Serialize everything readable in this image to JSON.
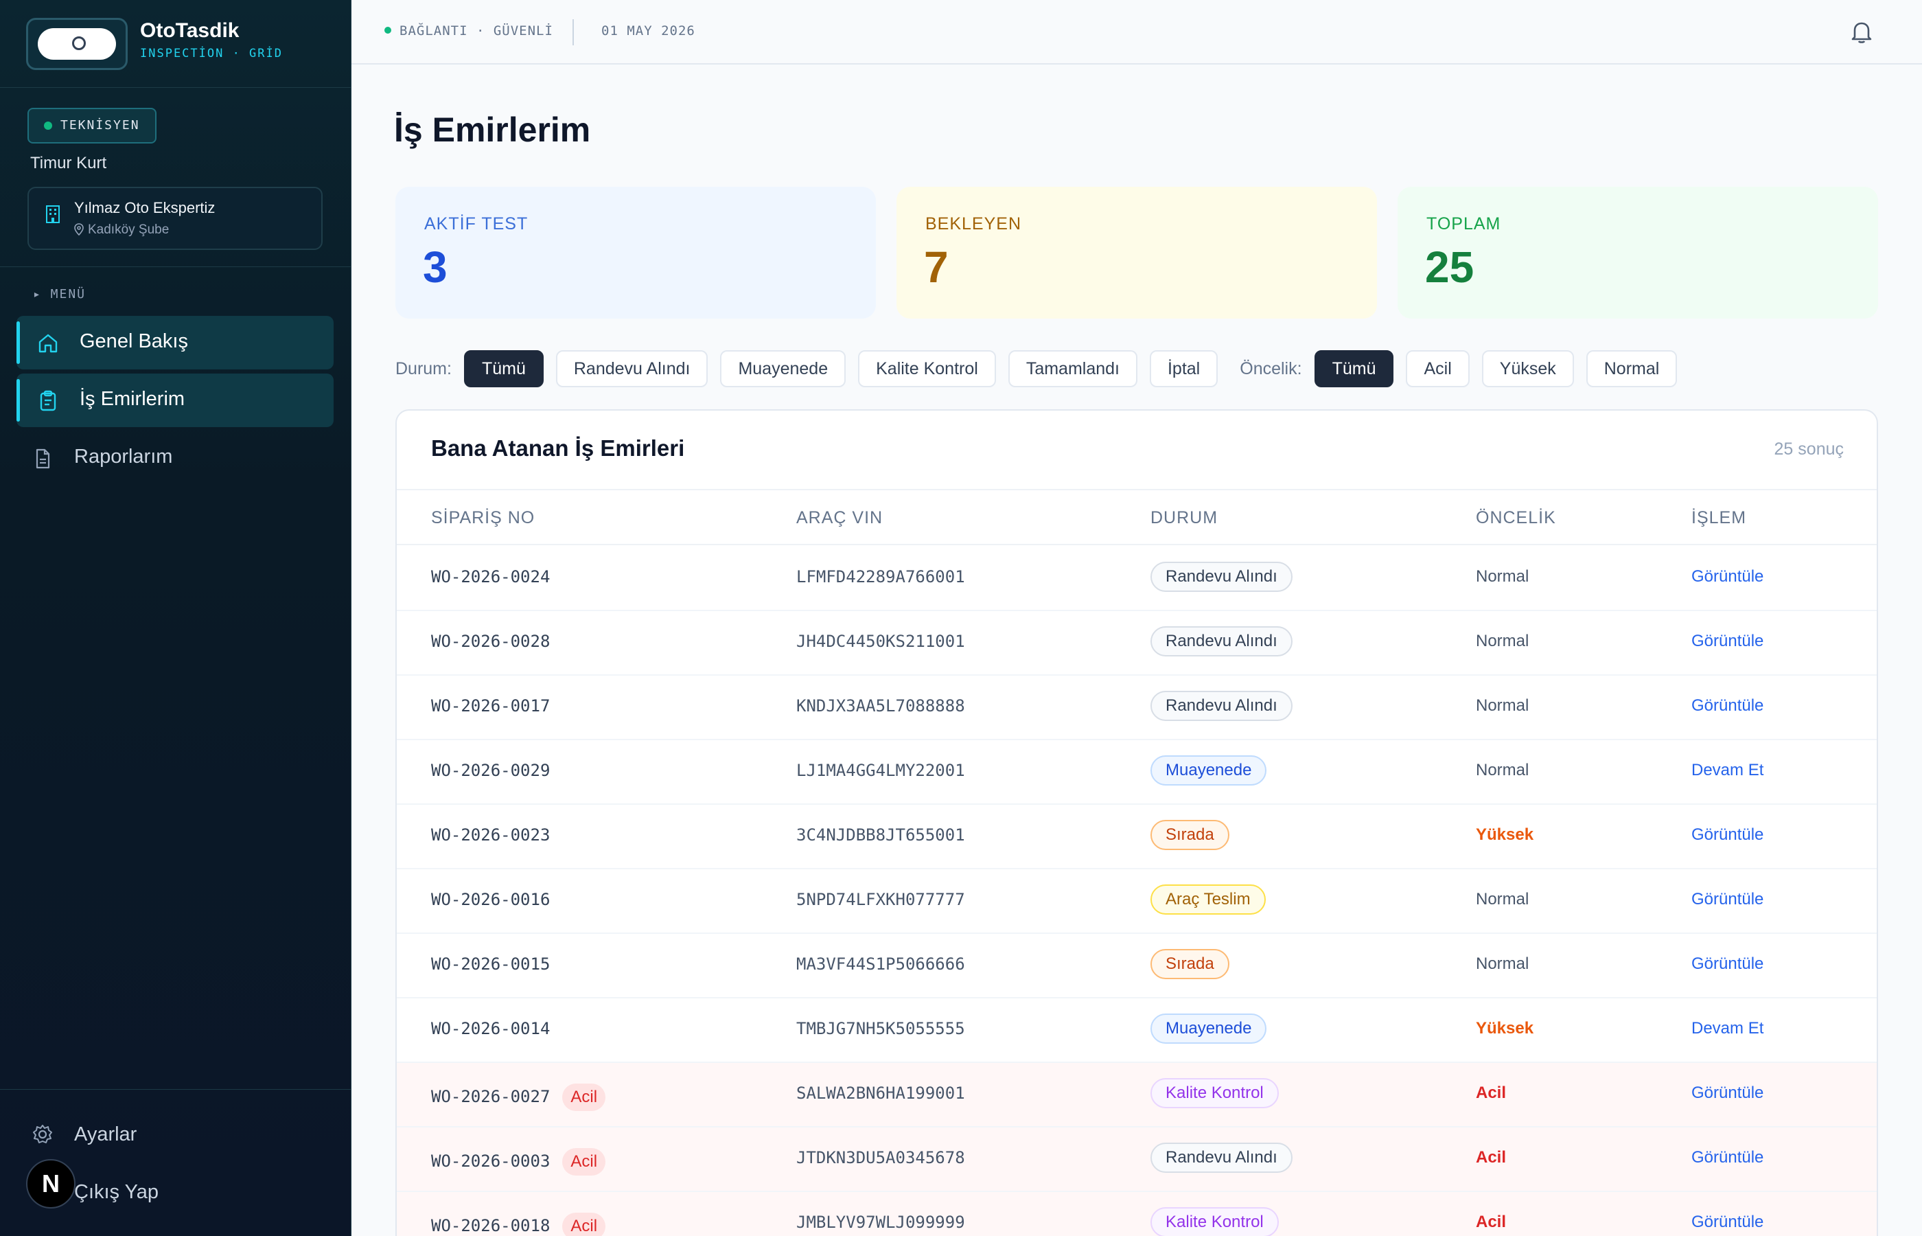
{
  "brand": {
    "name": "OtoTasdik",
    "subtitle": "INSPECTİON · GRİD"
  },
  "user": {
    "role": "TEKNİSYEN",
    "name": "Timur Kurt",
    "company": "Yılmaz Oto Ekspertiz",
    "branch": "Kadıköy Şube"
  },
  "menu": {
    "heading": "▸ MENÜ",
    "items": [
      {
        "label": "Genel Bakış",
        "icon": "home-icon"
      },
      {
        "label": "İş Emirlerim",
        "icon": "clipboard-icon"
      },
      {
        "label": "Raporlarım",
        "icon": "document-icon"
      }
    ],
    "settings": "Ayarlar",
    "logout": "Çıkış Yap",
    "avatar": "N"
  },
  "topbar": {
    "connection": "BAĞLANTI · GÜVENLİ",
    "date": "01 MAY 2026"
  },
  "page": {
    "title": "İş Emirlerim"
  },
  "stats": [
    {
      "label": "AKTİF TEST",
      "value": "3"
    },
    {
      "label": "BEKLEYEN",
      "value": "7"
    },
    {
      "label": "TOPLAM",
      "value": "25"
    }
  ],
  "filters": {
    "status_label": "Durum:",
    "status": [
      "Tümü",
      "Randevu Alındı",
      "Muayenede",
      "Kalite Kontrol",
      "Tamamlandı",
      "İptal"
    ],
    "priority_label": "Öncelik:",
    "priority": [
      "Tümü",
      "Acil",
      "Yüksek",
      "Normal"
    ]
  },
  "table": {
    "title": "Bana Atanan İş Emirleri",
    "count": "25 sonuç",
    "columns": [
      "SİPARİŞ NO",
      "ARAÇ VIN",
      "DURUM",
      "ÖNCELİK",
      "İŞLEM"
    ],
    "urgent_tag": "Acil",
    "rows": [
      {
        "order": "WO-2026-0024",
        "vin": "LFMFD42289A766001",
        "status": "Randevu Alındı",
        "priority": "Normal",
        "action": "Görüntüle"
      },
      {
        "order": "WO-2026-0028",
        "vin": "JH4DC4450KS211001",
        "status": "Randevu Alındı",
        "priority": "Normal",
        "action": "Görüntüle"
      },
      {
        "order": "WO-2026-0017",
        "vin": "KNDJX3AA5L7088888",
        "status": "Randevu Alındı",
        "priority": "Normal",
        "action": "Görüntüle"
      },
      {
        "order": "WO-2026-0029",
        "vin": "LJ1MA4GG4LMY22001",
        "status": "Muayenede",
        "priority": "Normal",
        "action": "Devam Et"
      },
      {
        "order": "WO-2026-0023",
        "vin": "3C4NJDBB8JT655001",
        "status": "Sırada",
        "priority": "Yüksek",
        "action": "Görüntüle"
      },
      {
        "order": "WO-2026-0016",
        "vin": "5NPD74LFXKH077777",
        "status": "Araç Teslim",
        "priority": "Normal",
        "action": "Görüntüle"
      },
      {
        "order": "WO-2026-0015",
        "vin": "MA3VF44S1P5066666",
        "status": "Sırada",
        "priority": "Normal",
        "action": "Görüntüle"
      },
      {
        "order": "WO-2026-0014",
        "vin": "TMBJG7NH5K5055555",
        "status": "Muayenede",
        "priority": "Yüksek",
        "action": "Devam Et"
      },
      {
        "order": "WO-2026-0027",
        "vin": "SALWA2BN6HA199001",
        "status": "Kalite Kontrol",
        "priority": "Acil",
        "action": "Görüntüle"
      },
      {
        "order": "WO-2026-0003",
        "vin": "JTDKN3DU5A0345678",
        "status": "Randevu Alındı",
        "priority": "Acil",
        "action": "Görüntüle"
      },
      {
        "order": "WO-2026-0018",
        "vin": "JMBLYV97WLJ099999",
        "status": "Kalite Kontrol",
        "priority": "Acil",
        "action": "Görüntüle"
      }
    ]
  },
  "colors": {
    "accent": "#22d3ee",
    "sidebar": "#0b1f2b",
    "link": "#2563eb",
    "urgent": "#dc2626",
    "high": "#ea580c"
  }
}
